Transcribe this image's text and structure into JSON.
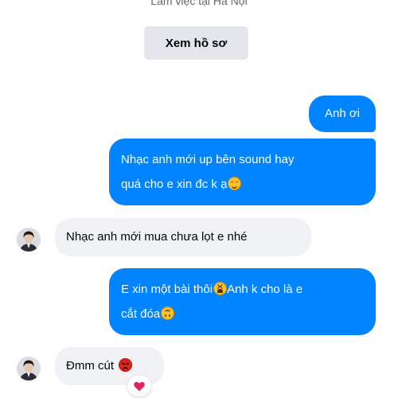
{
  "profile": {
    "subtitle": "Làm việc tại Hà Nội",
    "view_profile_label": "Xem hồ sơ"
  },
  "messages": [
    {
      "direction": "sent",
      "text": "Anh ơi"
    },
    {
      "direction": "sent",
      "text_line1": "Nhạc anh mới up bên sound hay",
      "text_line2": "quá cho e xin đc k ạ",
      "emoji": "smiling-face-emoji"
    },
    {
      "direction": "received",
      "text": "Nhạc anh mới mua chưa lọt e nhé"
    },
    {
      "direction": "sent",
      "text_part1": "E xin một bài thôi",
      "emoji1": "tired-face-emoji",
      "text_part2": "Anh k cho là e",
      "text_line2": "cắt đóa",
      "emoji2": "upside-down-face-emoji"
    },
    {
      "direction": "received",
      "text": "Đmm cút",
      "emoji": "angry-face-emoji",
      "reaction": "heart-icon"
    }
  ],
  "colors": {
    "sent_bubble": "#0084ff",
    "received_bubble": "#f0f2f5",
    "button_bg": "#e4e6eb",
    "reaction_heart": "#e0245e"
  }
}
